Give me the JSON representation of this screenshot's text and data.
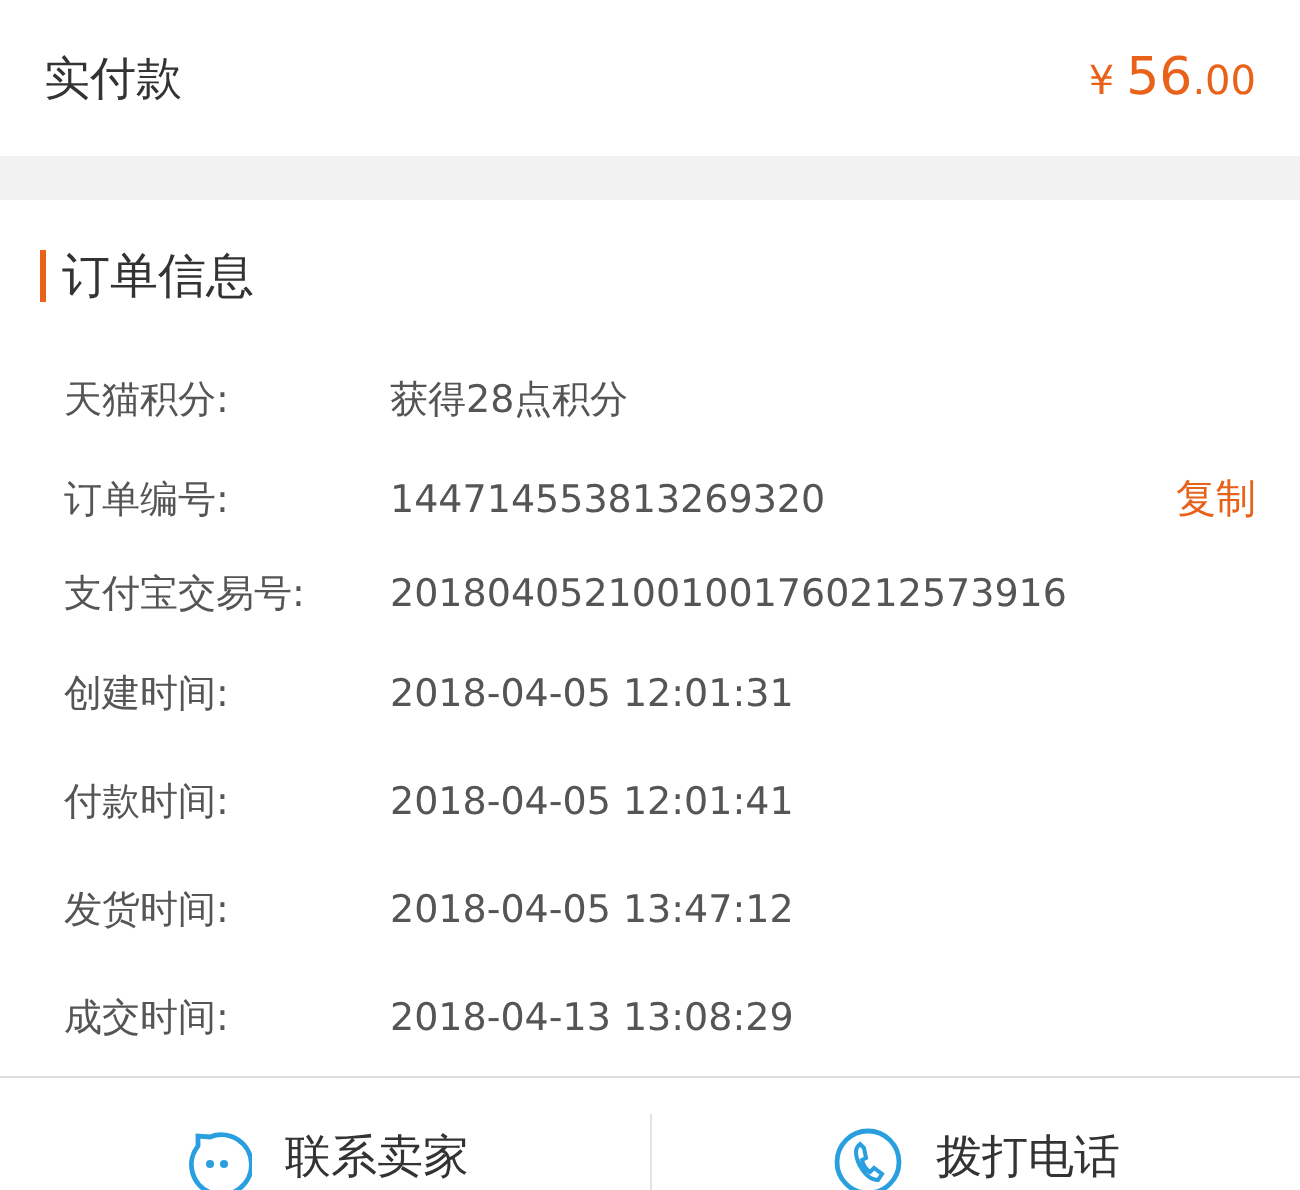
{
  "payment": {
    "label": "实付款",
    "currency": "¥",
    "integer": "56",
    "decimal": ".00"
  },
  "order_info": {
    "title": "订单信息",
    "rows": [
      {
        "label": "天猫积分:",
        "value": "获得28点积分"
      },
      {
        "label": "订单编号:",
        "value": "144714553813269320",
        "action": "复制"
      },
      {
        "label": "支付宝交易号:",
        "value": "2018040521001001760212573916"
      },
      {
        "label": "创建时间:",
        "value": "2018-04-05 12:01:31"
      },
      {
        "label": "付款时间:",
        "value": "2018-04-05 12:01:41"
      },
      {
        "label": "发货时间:",
        "value": "2018-04-05 13:47:12"
      },
      {
        "label": "成交时间:",
        "value": "2018-04-13 13:08:29"
      }
    ]
  },
  "bottom_actions": [
    {
      "kind": "chat",
      "label": "联系卖家"
    },
    {
      "kind": "phone",
      "label": "拨打电话"
    }
  ]
}
